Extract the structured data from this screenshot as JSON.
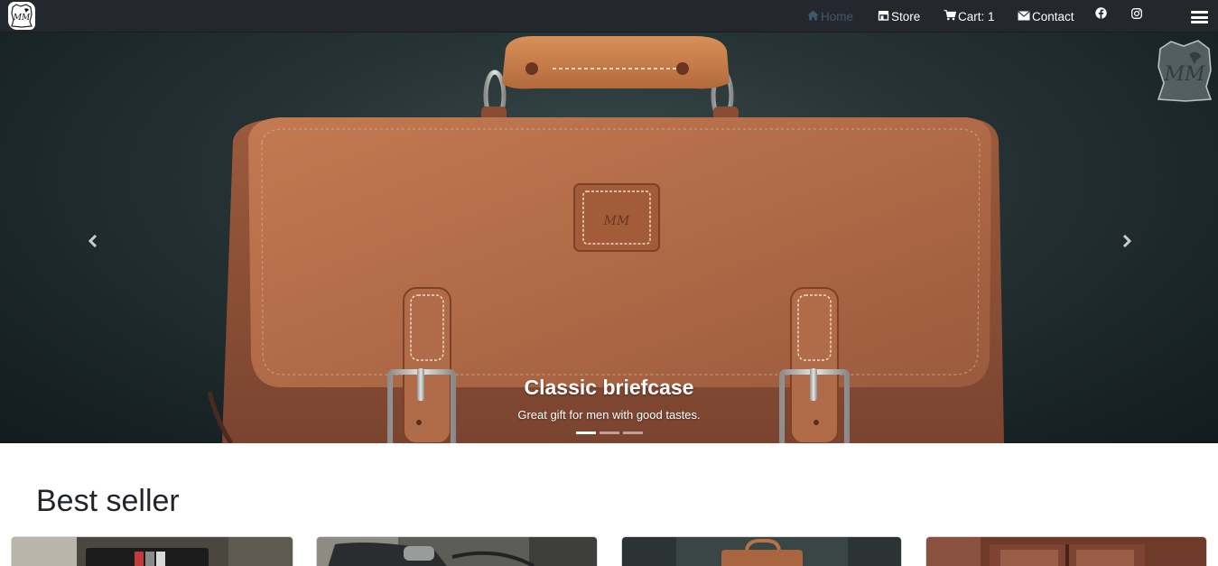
{
  "navbar": {
    "brand_logo_text": "MM",
    "links": [
      {
        "label": "Home",
        "icon": "home-icon",
        "active": true
      },
      {
        "label": "Store",
        "icon": "store-icon",
        "active": false
      },
      {
        "label": "Cart: 1",
        "icon": "cart-icon",
        "active": false
      },
      {
        "label": "Contact",
        "icon": "envelope-icon",
        "active": false
      }
    ],
    "social": [
      "facebook-icon",
      "instagram-icon"
    ],
    "menu_icon": "hamburger-icon",
    "active_color": "#3f5a6d"
  },
  "carousel": {
    "slide_title": "Classic briefcase",
    "slide_subtitle": "Great gift for men with good tastes.",
    "watermark_text": "MM",
    "slide_count": 3,
    "active_slide": 1
  },
  "best_seller": {
    "title": "Best seller",
    "product_count_visible": 4
  },
  "colors": {
    "navbar_bg": "#24272d",
    "leather": "#b56a46",
    "text_dark": "#212529"
  }
}
